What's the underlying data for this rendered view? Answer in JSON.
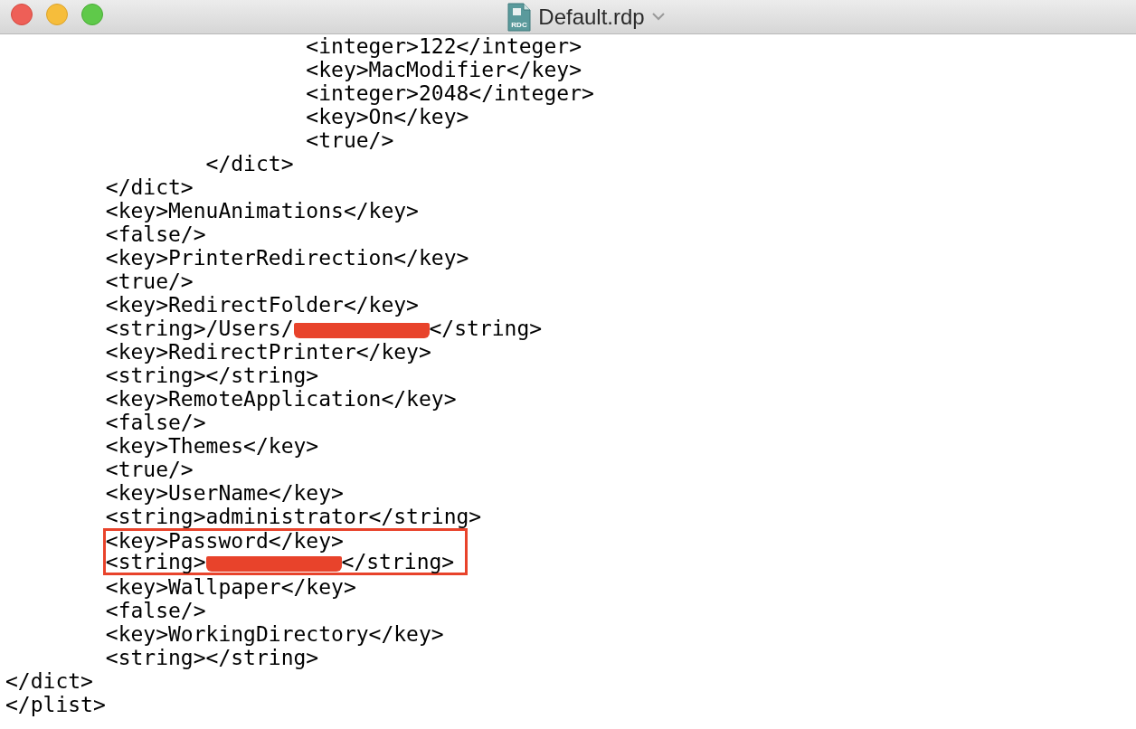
{
  "window": {
    "title": "Default.rdp",
    "file_icon_label": "RDC"
  },
  "lines": [
    {
      "kind": "line",
      "parts": [
        {
          "kind": "text",
          "text": "\t\t\t<integer>122</integer>"
        }
      ]
    },
    {
      "kind": "line",
      "parts": [
        {
          "kind": "text",
          "text": "\t\t\t<key>MacModifier</key>"
        }
      ]
    },
    {
      "kind": "line",
      "parts": [
        {
          "kind": "text",
          "text": "\t\t\t<integer>2048</integer>"
        }
      ]
    },
    {
      "kind": "line",
      "parts": [
        {
          "kind": "text",
          "text": "\t\t\t<key>On</key>"
        }
      ]
    },
    {
      "kind": "line",
      "parts": [
        {
          "kind": "text",
          "text": "\t\t\t<true/>"
        }
      ]
    },
    {
      "kind": "line",
      "parts": [
        {
          "kind": "text",
          "text": "\t\t</dict>"
        }
      ]
    },
    {
      "kind": "line",
      "parts": [
        {
          "kind": "text",
          "text": "\t</dict>"
        }
      ]
    },
    {
      "kind": "line",
      "parts": [
        {
          "kind": "text",
          "text": "\t<key>MenuAnimations</key>"
        }
      ]
    },
    {
      "kind": "line",
      "parts": [
        {
          "kind": "text",
          "text": "\t<false/>"
        }
      ]
    },
    {
      "kind": "line",
      "parts": [
        {
          "kind": "text",
          "text": "\t<key>PrinterRedirection</key>"
        }
      ]
    },
    {
      "kind": "line",
      "parts": [
        {
          "kind": "text",
          "text": "\t<true/>"
        }
      ]
    },
    {
      "kind": "line",
      "parts": [
        {
          "kind": "text",
          "text": "\t<key>RedirectFolder</key>"
        }
      ]
    },
    {
      "kind": "line",
      "parts": [
        {
          "kind": "text",
          "text": "\t<string>/Users/"
        },
        {
          "kind": "redaction"
        },
        {
          "kind": "text",
          "text": "</string>"
        }
      ]
    },
    {
      "kind": "line",
      "parts": [
        {
          "kind": "text",
          "text": "\t<key>RedirectPrinter</key>"
        }
      ]
    },
    {
      "kind": "line",
      "parts": [
        {
          "kind": "text",
          "text": "\t<string></string>"
        }
      ]
    },
    {
      "kind": "line",
      "parts": [
        {
          "kind": "text",
          "text": "\t<key>RemoteApplication</key>"
        }
      ]
    },
    {
      "kind": "line",
      "parts": [
        {
          "kind": "text",
          "text": "\t<false/>"
        }
      ]
    },
    {
      "kind": "line",
      "parts": [
        {
          "kind": "text",
          "text": "\t<key>Themes</key>"
        }
      ]
    },
    {
      "kind": "line",
      "parts": [
        {
          "kind": "text",
          "text": "\t<true/>"
        }
      ]
    },
    {
      "kind": "line",
      "parts": [
        {
          "kind": "text",
          "text": "\t<key>UserName</key>"
        }
      ]
    },
    {
      "kind": "line",
      "parts": [
        {
          "kind": "text",
          "text": "\t<string>administrator</string>"
        }
      ]
    },
    {
      "kind": "boxed",
      "lines": [
        {
          "kind": "line",
          "parts": [
            {
              "kind": "text",
              "text": "\t<key>Password</key>"
            }
          ]
        },
        {
          "kind": "line",
          "parts": [
            {
              "kind": "text",
              "text": "\t<string>"
            },
            {
              "kind": "redaction"
            },
            {
              "kind": "text",
              "text": "</string>"
            }
          ]
        }
      ]
    },
    {
      "kind": "line",
      "parts": [
        {
          "kind": "text",
          "text": "\t<key>Wallpaper</key>"
        }
      ]
    },
    {
      "kind": "line",
      "parts": [
        {
          "kind": "text",
          "text": "\t<false/>"
        }
      ]
    },
    {
      "kind": "line",
      "parts": [
        {
          "kind": "text",
          "text": "\t<key>WorkingDirectory</key>"
        }
      ]
    },
    {
      "kind": "line",
      "parts": [
        {
          "kind": "text",
          "text": "\t<string></string>"
        }
      ]
    },
    {
      "kind": "line",
      "parts": [
        {
          "kind": "text",
          "text": "</dict>"
        }
      ]
    },
    {
      "kind": "line",
      "parts": [
        {
          "kind": "text",
          "text": "</plist>"
        }
      ]
    }
  ]
}
